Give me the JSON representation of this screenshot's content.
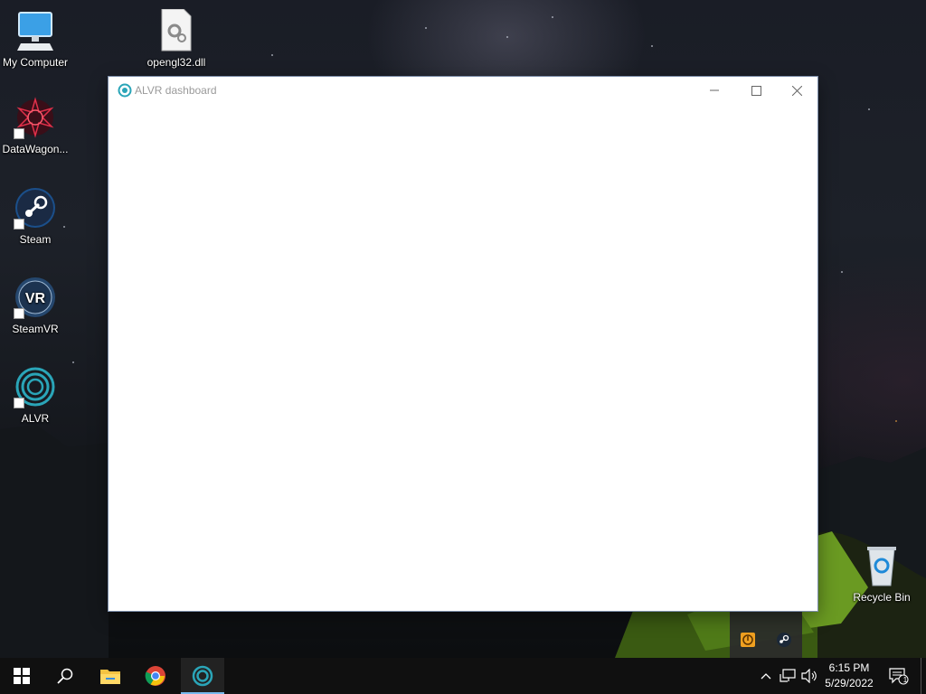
{
  "desktop": {
    "icons": [
      {
        "label": "My Computer",
        "icon": "computer-icon"
      },
      {
        "label": "opengl32.dll",
        "icon": "dll-file-icon"
      },
      {
        "label": "DataWagon...",
        "icon": "datawagon-icon"
      },
      {
        "label": "Steam",
        "icon": "steam-icon"
      },
      {
        "label": "SteamVR",
        "icon": "steamvr-icon"
      },
      {
        "label": "ALVR",
        "icon": "alvr-icon"
      },
      {
        "label": "Recycle Bin",
        "icon": "recycle-bin-icon"
      }
    ]
  },
  "window": {
    "title": "ALVR dashboard",
    "icon": "alvr-icon",
    "controls": [
      "minimize-icon",
      "maximize-icon",
      "close-icon"
    ]
  },
  "tray_popup": {
    "icons": [
      "security-shield-icon",
      "onedrive-icon",
      "app-tray-icon",
      "steam-tray-icon"
    ]
  },
  "taskbar": {
    "buttons": [
      "windows-start-icon",
      "search-icon",
      "file-explorer-icon",
      "chrome-icon",
      "alvr-icon"
    ],
    "active": "alvr-icon",
    "system": {
      "time": "6:15 PM",
      "date": "5/29/2022",
      "notification_count": "1"
    }
  },
  "colors": {
    "accent": "#76b9ed",
    "taskbar": "#101010",
    "alvr": "#2aa5b8"
  }
}
